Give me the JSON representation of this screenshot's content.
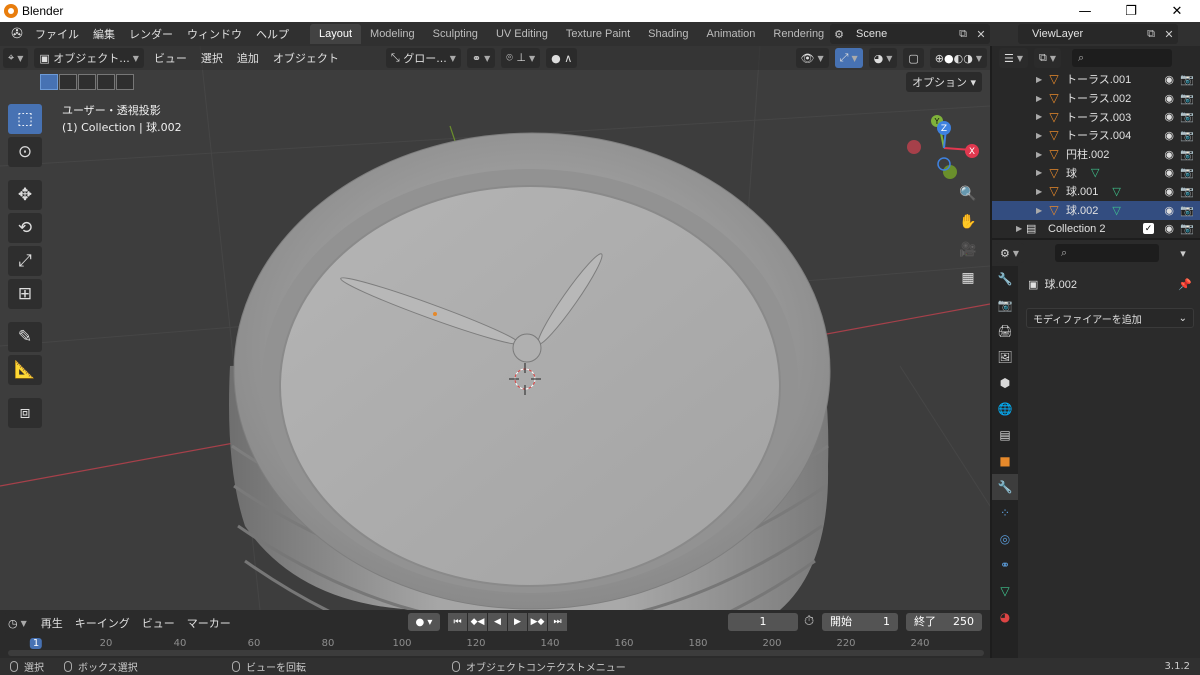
{
  "window": {
    "title": "Blender",
    "controls": [
      "—",
      "❐",
      "✕"
    ]
  },
  "topbar": {
    "menus": [
      "ファイル",
      "編集",
      "レンダー",
      "ウィンドウ",
      "ヘルプ"
    ],
    "tabs": [
      "Layout",
      "Modeling",
      "Sculpting",
      "UV Editing",
      "Texture Paint",
      "Shading",
      "Animation",
      "Rendering"
    ],
    "active_tab": "Layout",
    "scene": "Scene",
    "view_layer": "ViewLayer"
  },
  "viewport": {
    "mode": "オブジェクト...",
    "menus": [
      "ビュー",
      "選択",
      "追加",
      "オブジェクト"
    ],
    "transform_orientation": "グロー...",
    "options_label": "オプション",
    "info_line1": "ユーザー・透視投影",
    "info_line2": "(1) Collection | 球.002",
    "gizmo": {
      "x": "X",
      "y": "Y",
      "z": "Z"
    },
    "colors": {
      "x_axis": "#e0384f",
      "y_axis": "#7fb23a",
      "z_axis": "#3f82e0",
      "bg": "#3d3d3d",
      "mesh": "#a8a8a8"
    }
  },
  "timeline": {
    "menus": [
      "再生",
      "キーイング",
      "ビュー",
      "マーカー"
    ],
    "current_frame": "1",
    "start_label": "開始",
    "start_value": "1",
    "end_label": "終了",
    "end_value": "250",
    "ruler": [
      "1",
      "20",
      "40",
      "60",
      "80",
      "100",
      "120",
      "140",
      "160",
      "180",
      "200",
      "220",
      "240"
    ]
  },
  "statusbar": {
    "select": "選択",
    "box_select": "ボックス選択",
    "rotate_view": "ビューを回転",
    "context_menu": "オブジェクトコンテクストメニュー",
    "version": "3.1.2"
  },
  "outliner": {
    "items": [
      {
        "name": "トーラス.001",
        "selected": false,
        "modifier": false
      },
      {
        "name": "トーラス.002",
        "selected": false,
        "modifier": false
      },
      {
        "name": "トーラス.003",
        "selected": false,
        "modifier": false
      },
      {
        "name": "トーラス.004",
        "selected": false,
        "modifier": false
      },
      {
        "name": "円柱.002",
        "selected": false,
        "modifier": false
      },
      {
        "name": "球",
        "selected": false,
        "modifier": true
      },
      {
        "name": "球.001",
        "selected": false,
        "modifier": true
      },
      {
        "name": "球.002",
        "selected": true,
        "modifier": true
      }
    ],
    "collection2": "Collection 2"
  },
  "properties": {
    "object_name": "球.002",
    "add_modifier": "モディファイアーを追加"
  }
}
